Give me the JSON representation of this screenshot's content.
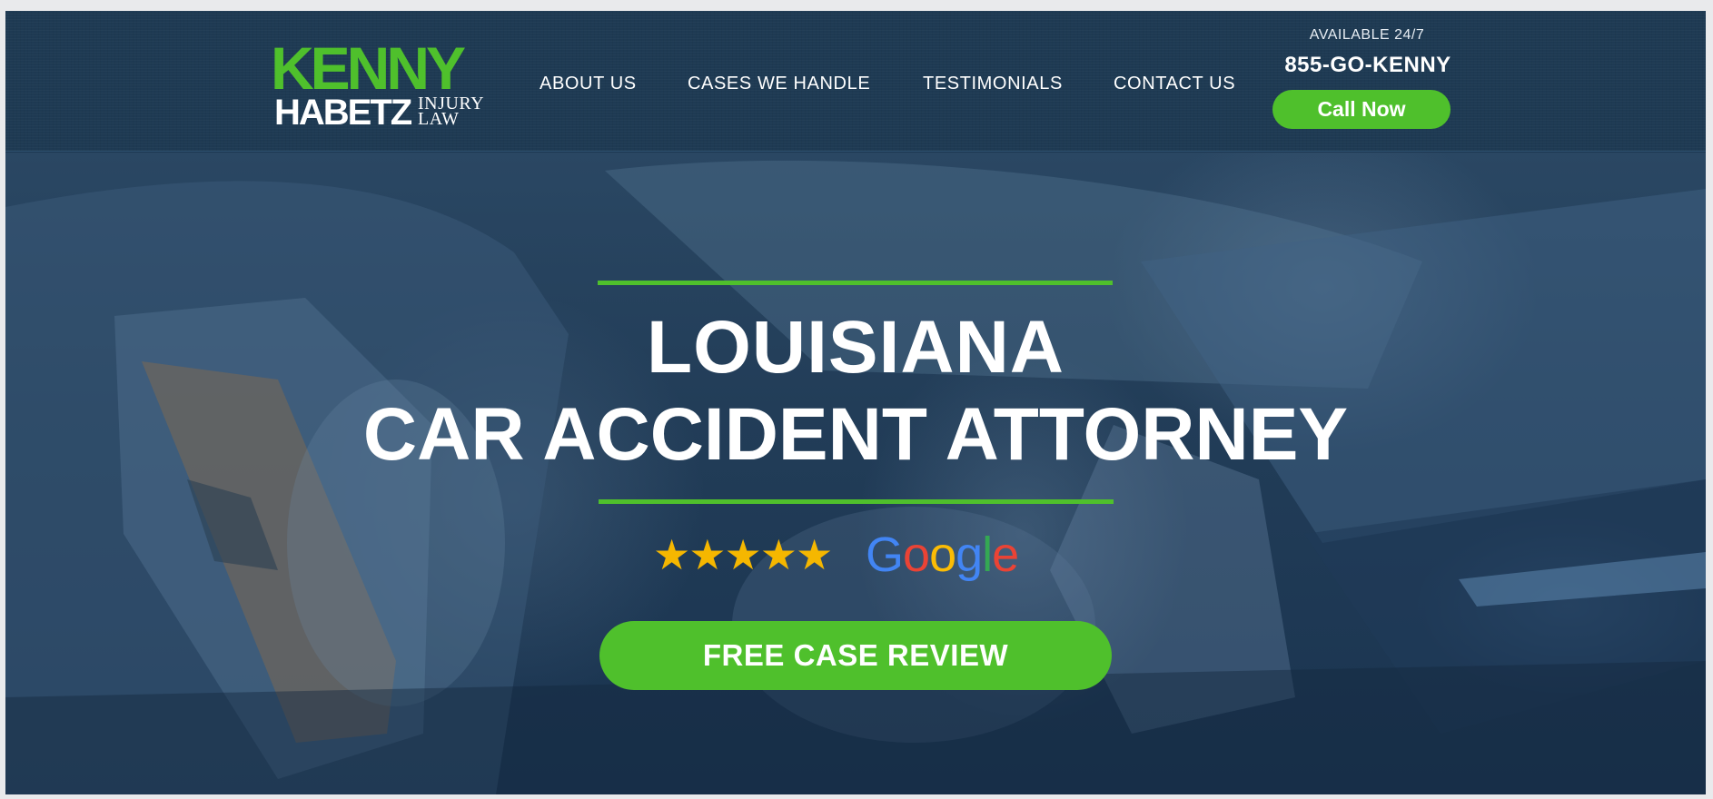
{
  "logo": {
    "top": "KENNY",
    "bottom": "HABETZ",
    "side_line1": "INJURY",
    "side_line2": "LAW"
  },
  "nav": {
    "items": [
      {
        "label": "ABOUT US"
      },
      {
        "label": "CASES WE HANDLE"
      },
      {
        "label": "TESTIMONIALS"
      },
      {
        "label": "CONTACT US"
      }
    ]
  },
  "contact": {
    "availability": "AVAILABLE 24/7",
    "phone": "855-GO-KENNY",
    "call_label": "Call Now"
  },
  "hero": {
    "title_line1": "LOUISIANA",
    "title_line2": "CAR ACCIDENT ATTORNEY",
    "rating": {
      "stars": 5,
      "star_glyphs": "★★★★★",
      "source": "Google"
    },
    "cta_label": "FREE CASE REVIEW"
  },
  "colors": {
    "brand_green": "#4fc02c",
    "header_navy": "#1e3a53",
    "star_gold": "#f5b700",
    "google_blue": "#4285f4",
    "google_red": "#ea4335",
    "google_yellow": "#fbbc05",
    "google_green": "#34a853"
  }
}
